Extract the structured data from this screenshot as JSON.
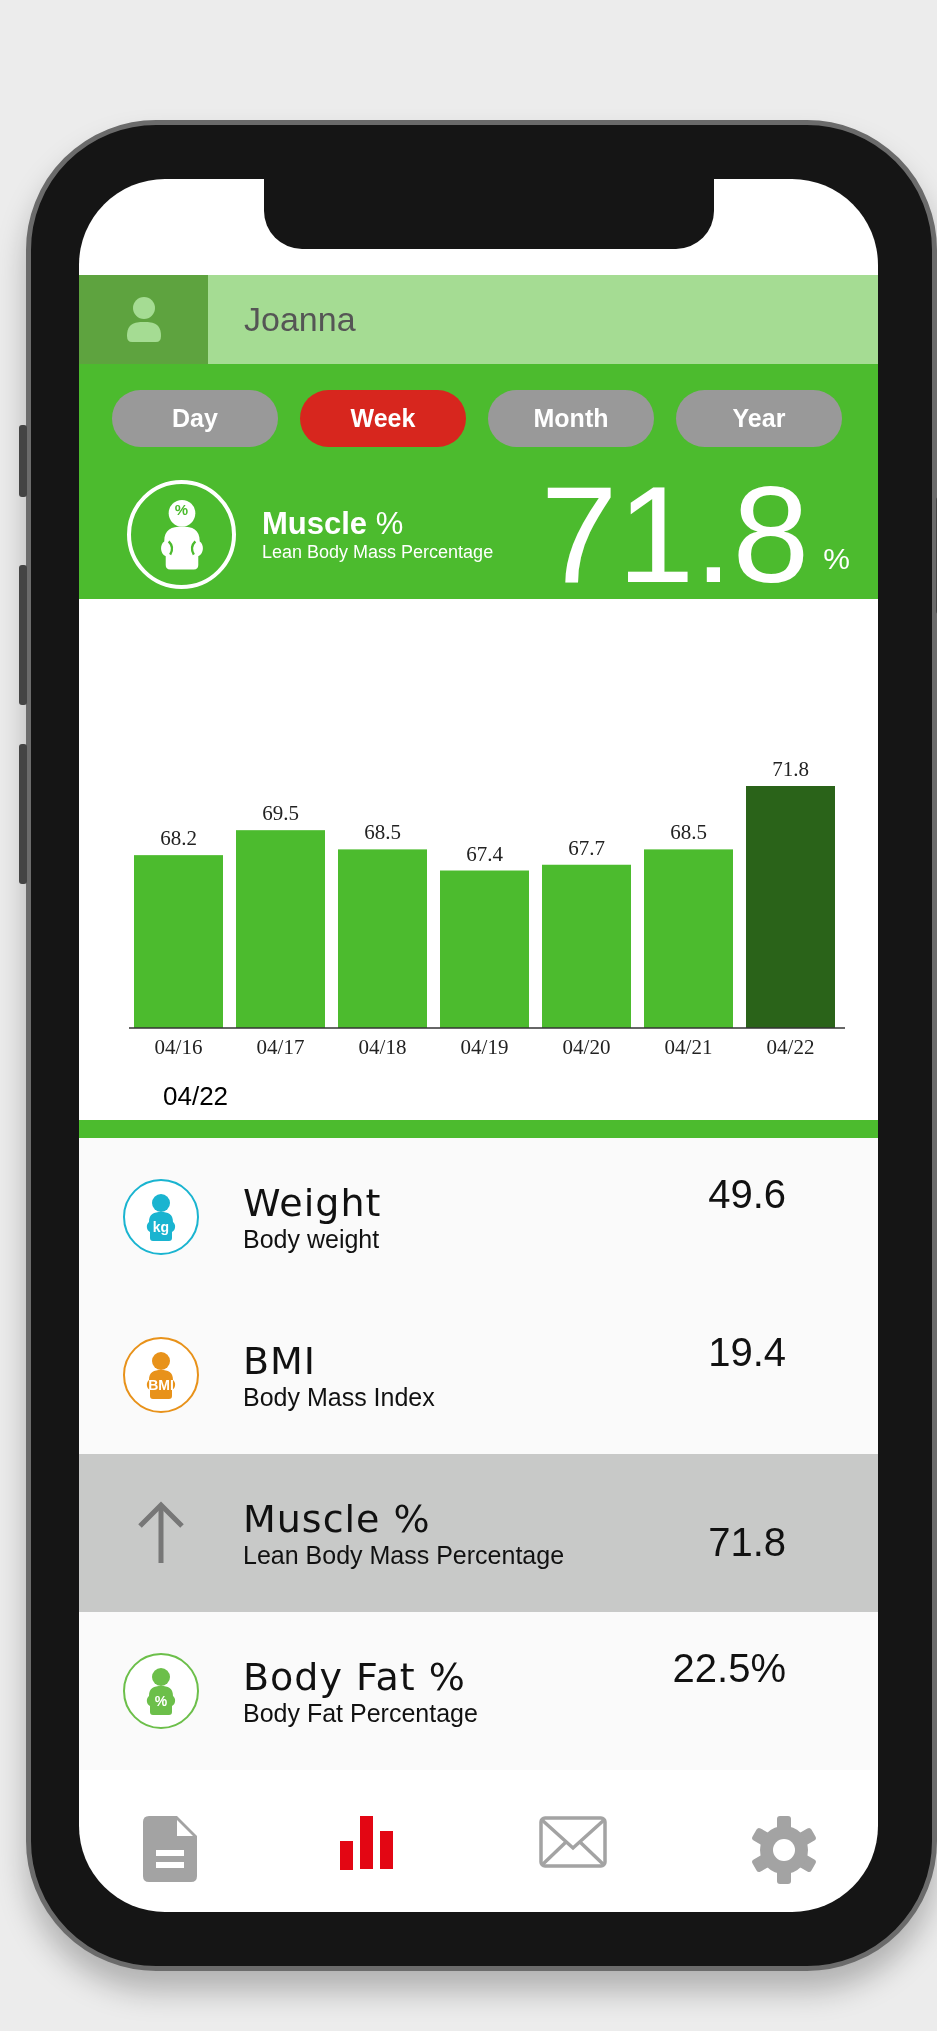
{
  "profile": {
    "name": "Joanna"
  },
  "tabs": [
    {
      "label": "Day",
      "selected": false
    },
    {
      "label": "Week",
      "selected": true
    },
    {
      "label": "Month",
      "selected": false
    },
    {
      "label": "Year",
      "selected": false
    }
  ],
  "summary": {
    "badge": "%",
    "title": "**Muscle** %",
    "subtitle": "Lean Body Mass Percentage",
    "value": "71.8",
    "unit": "%"
  },
  "chart": {
    "chart_data": {
      "type": "bar",
      "categories": [
        "04/16",
        "04/17",
        "04/18",
        "04/19",
        "04/20",
        "04/21",
        "04/22"
      ],
      "ylim": [
        59.2,
        71.8
      ],
      "stacked": true,
      "data_labels": true,
      "series": [
        {
          "color": "#4cbb2e",
          "values": [
            68.2,
            69.5,
            68.5,
            67.4,
            67.7,
            68.5,
            null
          ]
        },
        {
          "color": "#2a6319",
          "values": [
            null,
            null,
            null,
            null,
            null,
            null,
            71.8
          ]
        }
      ]
    },
    "selected_date": "04/22"
  },
  "metrics": [
    {
      "kind": "badge",
      "badge": "kg",
      "color": "#1ab4d0",
      "title": "Weight",
      "subtitle": "Body weight",
      "value": "49.6",
      "selected": false
    },
    {
      "kind": "badge",
      "badge": "BMI",
      "color": "#e8921a",
      "title": "BMI",
      "subtitle": "Body Mass Index",
      "value": "19.4",
      "selected": false
    },
    {
      "kind": "arrow",
      "title": "Muscle %",
      "subtitle": "Lean Body Mass Percentage",
      "value": "71.8",
      "selected": true
    },
    {
      "kind": "badge",
      "badge": "%",
      "color": "#6cbf4a",
      "title": "Body Fat %",
      "subtitle": "Body Fat Percentage",
      "value": "22.5%",
      "selected": false
    }
  ],
  "nav": [
    {
      "kind": "document",
      "selected": false
    },
    {
      "kind": "chart",
      "selected": true
    },
    {
      "kind": "mail",
      "selected": false
    },
    {
      "kind": "settings",
      "selected": false
    }
  ]
}
